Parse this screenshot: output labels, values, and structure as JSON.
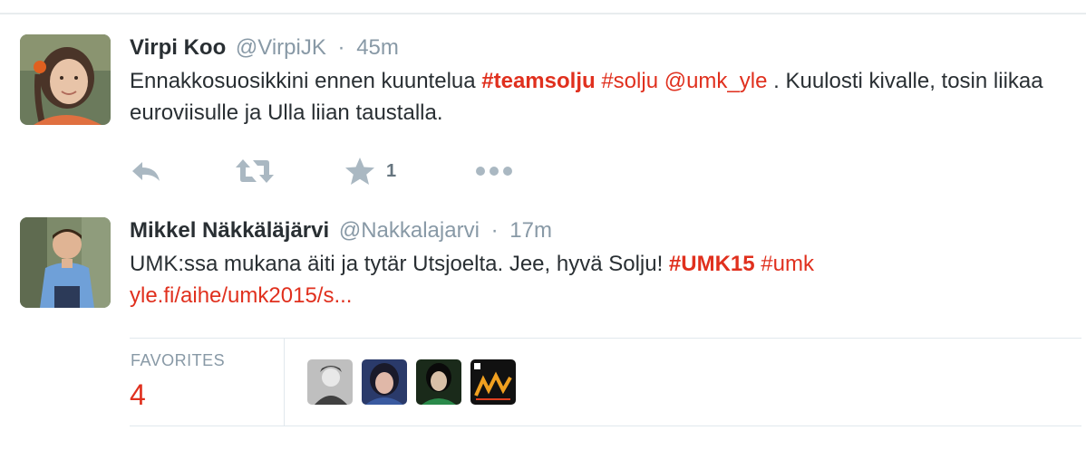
{
  "tweets": [
    {
      "name": "Virpi Koo",
      "handle": "@VirpiJK",
      "separator": "·",
      "time": "45m",
      "text": {
        "part1": "Ennakkosuosikkini ennen kuuntelua ",
        "hashtag1": "#teamsolju",
        "space1": " ",
        "hashtag2": "#solju",
        "space2": " ",
        "mention": "@umk_yle",
        "part2": " . Kuulosti kivalle, tosin liikaa euroviisulle ja Ulla liian taustalla."
      },
      "actions": {
        "reply_icon": "reply-icon",
        "retweet_icon": "retweet-icon",
        "favorite_icon": "star-icon",
        "favorite_count": "1",
        "more_icon": "more-dots-icon"
      }
    },
    {
      "name": "Mikkel Näkkäläjärvi",
      "handle": "@Nakkalajarvi",
      "separator": "·",
      "time": "17m",
      "text": {
        "part1": "UMK:ssa mukana äiti ja tytär Utsjoelta. Jee, hyvä Solju! ",
        "hashtag1": "#UMK15",
        "space1": " ",
        "hashtag2": "#umk",
        "link": "yle.fi/aihe/umk2015/s..."
      },
      "stats": {
        "favorites_label": "FAVORITES",
        "favorites_value": "4"
      }
    }
  ],
  "colors": {
    "accent": "#e0301e",
    "meta_gray": "#8899a6",
    "text": "#292f33",
    "icon_gray": "#aab8c2",
    "border": "#e1e8ed"
  }
}
